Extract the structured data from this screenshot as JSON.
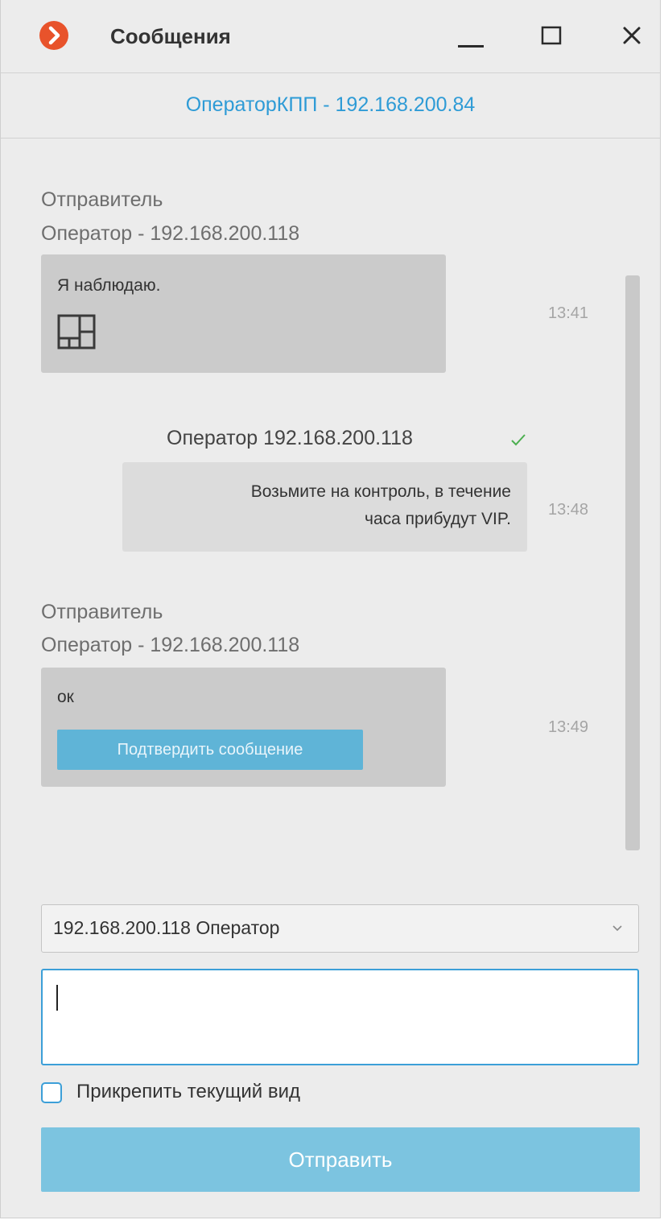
{
  "window": {
    "title": "Сообщения",
    "icon": "arrow-right-logo-icon",
    "controls": [
      "minimize-icon",
      "maximize-icon",
      "close-icon"
    ],
    "accent_color": "#2e9bd6",
    "logo_color": "#e8532b"
  },
  "contact": {
    "name": "ОператорКПП - 192.168.200.84"
  },
  "messages": [
    {
      "direction": "incoming",
      "sender_label": "Отправитель",
      "sender": "Оператор - 192.168.200.118",
      "text": "Я наблюдаю.",
      "attachment_icon": "layout-grid-icon",
      "time": "13:41"
    },
    {
      "direction": "outgoing",
      "recipient": "Оператор 192.168.200.118",
      "status_icon": "checkmark-icon",
      "text_line1": "Возьмите на контроль, в течение",
      "text_line2": "часа прибудут VIP.",
      "time": "13:48"
    },
    {
      "direction": "incoming",
      "sender_label": "Отправитель",
      "sender": "Оператор - 192.168.200.118",
      "text": "ок",
      "action_label": "Подтвердить сообщение",
      "time": "13:49"
    }
  ],
  "composer": {
    "recipient_selected": "192.168.200.118 Оператор",
    "message_value": "",
    "attach_view_label": "Прикрепить текущий вид",
    "attach_view_checked": false,
    "send_label": "Отправить"
  }
}
